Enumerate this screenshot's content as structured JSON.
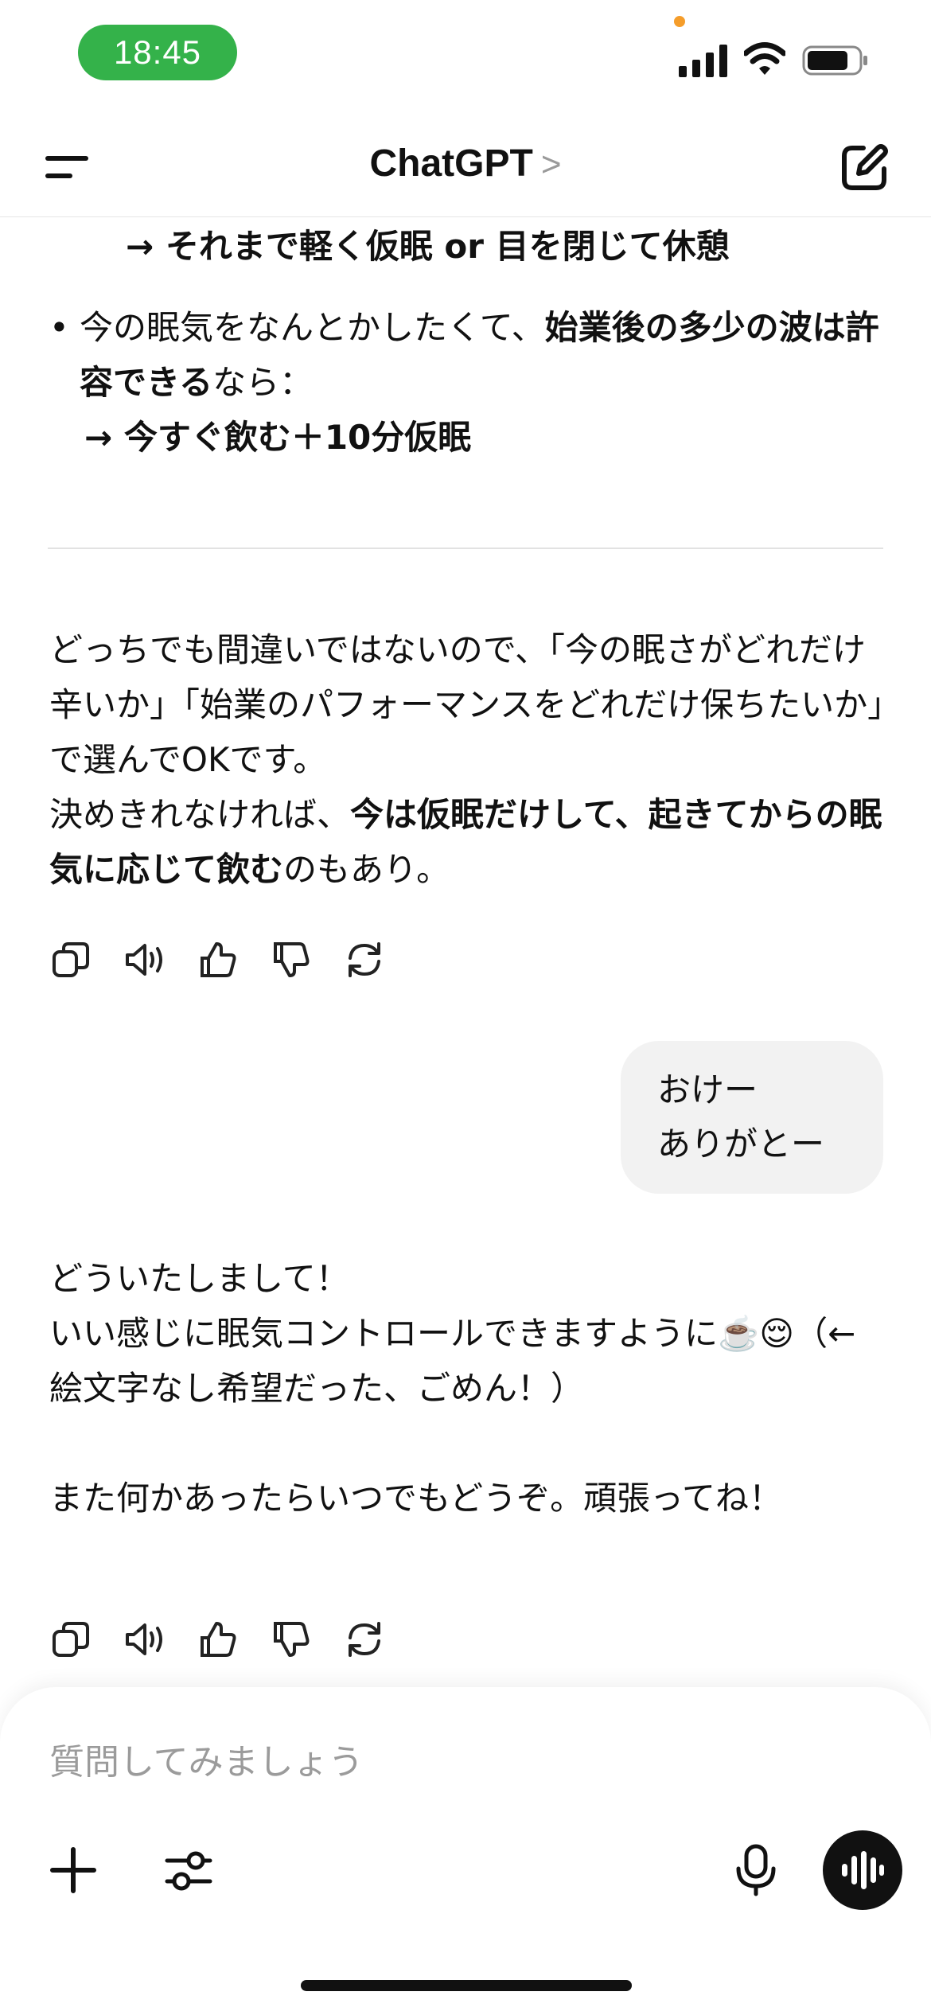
{
  "status_bar": {
    "time": "18:45",
    "icons": [
      "signal-icon",
      "wifi-icon",
      "battery-icon"
    ],
    "accent": "#34b24a"
  },
  "nav": {
    "title": "ChatGPT",
    "title_chevron": ">",
    "icons": [
      "menu-icon",
      "new-chat-icon"
    ]
  },
  "messages": {
    "ai_1": {
      "sub_line": "→ それまで軽く仮眠 or 目を閉じて休憩",
      "bullet_prefix": "今の眠気をなんとかしたくて、",
      "bullet_bold": "始業後の多少の波は許容できる",
      "bullet_suffix": "なら：",
      "bullet_sub": "→ 今すぐ飲む＋10分仮眠"
    },
    "ai_2": {
      "line_1": "どっちでも間違いではないので、「今の眠さがどれだけ辛いか」「始業のパフォーマンスをどれだけ保ちたいか」で選んでOKです。",
      "line_2_prefix": "決めきれなければ、",
      "line_2_bold": "今は仮眠だけして、起きてからの眠気に応じて飲む",
      "line_2_suffix": "のもあり。"
    },
    "user_1": {
      "text": "おけー\nありがとー"
    },
    "ai_3": {
      "line_1": "どういたしまして！",
      "line_2": "いい感じに眠気コントロールできますように☕️😌（← 絵文字なし希望だった、ごめん！）",
      "line_3": "また何かあったらいつでもどうぞ。頑張ってね！"
    }
  },
  "message_actions": [
    "copy-icon",
    "read-aloud-icon",
    "thumbs-up-icon",
    "thumbs-down-icon",
    "regenerate-icon"
  ],
  "composer": {
    "placeholder": "質問してみましょう",
    "icons": [
      "plus-icon",
      "tools-icon",
      "microphone-icon",
      "voice-mode-icon"
    ]
  }
}
